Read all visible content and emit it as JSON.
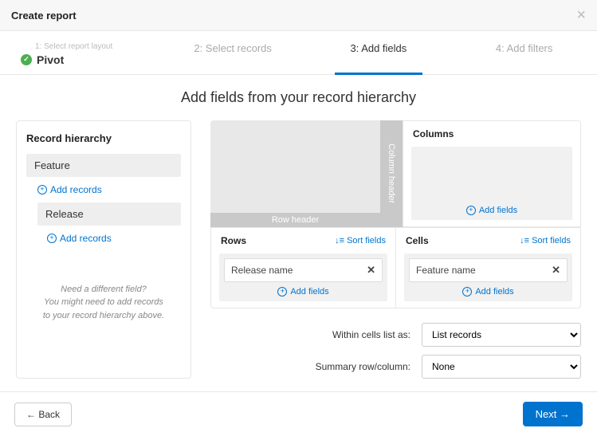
{
  "header": {
    "title": "Create report"
  },
  "steps": {
    "s1_super": "1: Select report layout",
    "s1_main": "Pivot",
    "s2": "2: Select records",
    "s3": "3: Add fields",
    "s4": "4: Add filters"
  },
  "body_title": "Add fields from your record hierarchy",
  "hierarchy": {
    "title": "Record hierarchy",
    "item1": "Feature",
    "add1": "Add records",
    "item2": "Release",
    "add2": "Add records",
    "help1": "Need a different field?",
    "help2": "You might need to add records",
    "help3": "to your record hierarchy above."
  },
  "designer": {
    "row_header": "Row header",
    "col_header": "Column header",
    "columns_title": "Columns",
    "rows_title": "Rows",
    "cells_title": "Cells",
    "sort": "Sort fields",
    "add_fields": "Add fields",
    "row_pill": "Release name",
    "cell_pill": "Feature name"
  },
  "form": {
    "within_label": "Within cells list as:",
    "within_value": "List records",
    "summary_label": "Summary row/column:",
    "summary_value": "None"
  },
  "footer": {
    "back": "← Back",
    "next": "Next →"
  }
}
